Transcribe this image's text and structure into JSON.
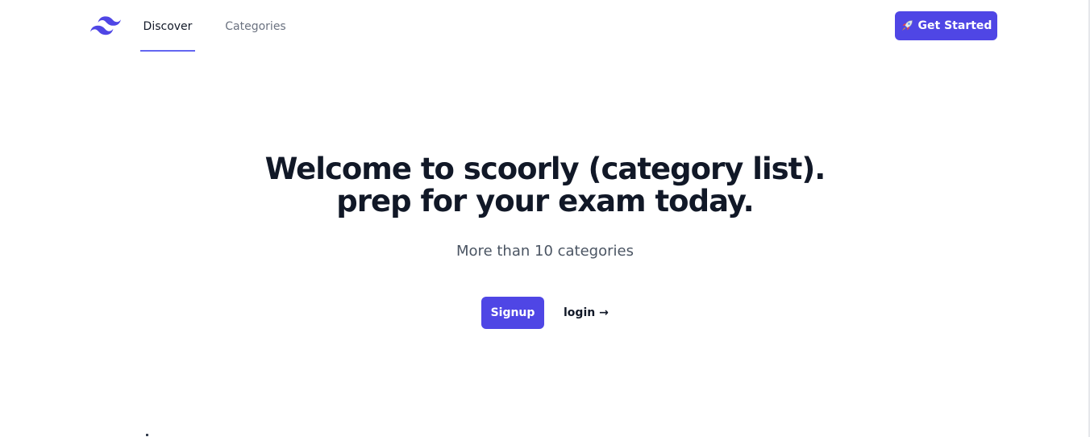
{
  "nav": {
    "logo_icon": "tailwind-wave-icon",
    "links": [
      {
        "label": "Discover",
        "active": true
      },
      {
        "label": "Categories",
        "active": false
      }
    ],
    "cta_label": "Get Started",
    "cta_icon": "rocket-icon"
  },
  "hero": {
    "title_line1": "Welcome to scoorly (category list).",
    "title_line2": "prep for your exam today.",
    "subtitle": "More than 10 categories",
    "signup_label": "Signup",
    "login_label": "login →"
  },
  "colors": {
    "accent": "#4f46e5",
    "accent_underline": "#6366f1",
    "heading": "#111827",
    "muted": "#6b7280"
  }
}
